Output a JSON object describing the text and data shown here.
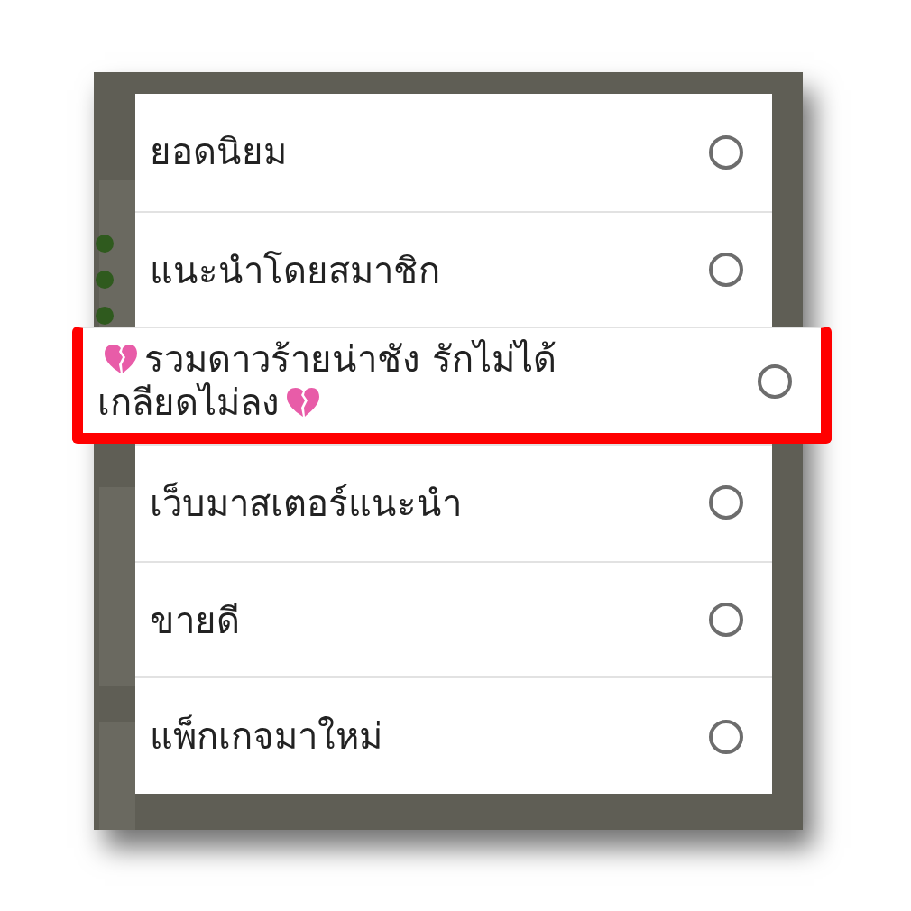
{
  "options": [
    {
      "label": "ยอดนิยม",
      "kind": "plain",
      "selected": false,
      "highlighted": false
    },
    {
      "label": "แนะนำโดยสมาชิก",
      "kind": "plain",
      "selected": false,
      "highlighted": false
    },
    {
      "lines": [
        "รวมดาวร้ายน่าชัง รักไม่ได้",
        "เกลียดไม่ลง"
      ],
      "kind": "decorated",
      "selected": false,
      "highlighted": true
    },
    {
      "label": "เว็บมาสเตอร์แนะนำ",
      "kind": "plain",
      "selected": false,
      "highlighted": false
    },
    {
      "label": "ขายดี",
      "kind": "plain",
      "selected": false,
      "highlighted": false
    },
    {
      "label": "แพ็กเกจมาใหม่",
      "kind": "plain",
      "selected": false,
      "highlighted": false
    }
  ]
}
